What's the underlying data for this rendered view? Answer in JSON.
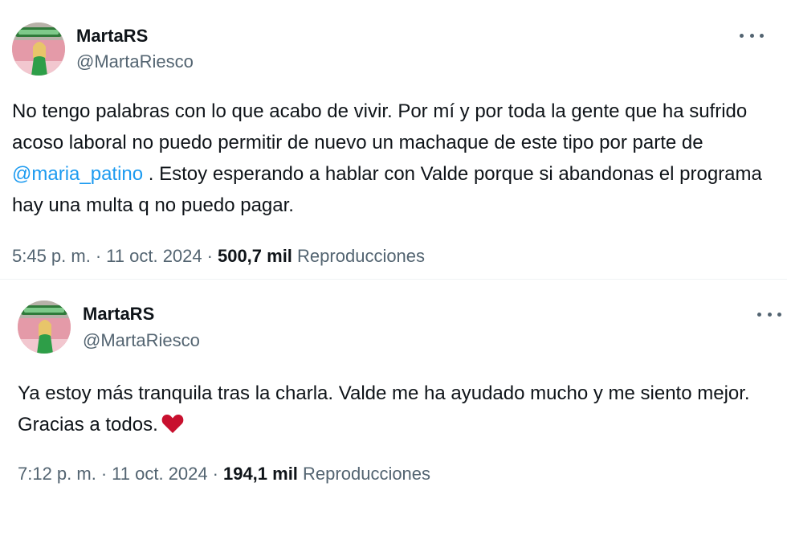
{
  "tweets": [
    {
      "display_name": "MartaRS",
      "handle": "@MartaRiesco",
      "text_before": "No tengo palabras con lo que acabo de vivir. Por mí y por toda la gente que ha sufrido acoso laboral no puedo permitir de nuevo un machaque de este tipo por parte de ",
      "mention": "@maria_patino",
      "text_after": " . Estoy esperando a hablar con Valde porque si abandonas el programa hay una multa q no puedo pagar.",
      "time": "5:45 p. m.",
      "date": "11 oct. 2024",
      "separator": "·",
      "views": "500,7 mil",
      "views_label": "Reproducciones",
      "more_icon": "ellipsis-icon",
      "avatar_icon": "profile-photo"
    },
    {
      "display_name": "MartaRS",
      "handle": "@MartaRiesco",
      "text": "Ya estoy más tranquila tras la charla. Valde me ha ayudado mucho y me siento mejor. Gracias a todos.",
      "emoji": "red-heart",
      "time": "7:12 p. m.",
      "date": "11 oct. 2024",
      "separator": "·",
      "views": "194,1 mil",
      "views_label": "Reproducciones",
      "more_icon": "ellipsis-icon",
      "avatar_icon": "profile-photo"
    }
  ],
  "colors": {
    "text": "#0f1419",
    "secondary": "#536471",
    "mention": "#1d9bf0",
    "heart": "#c8102e"
  }
}
